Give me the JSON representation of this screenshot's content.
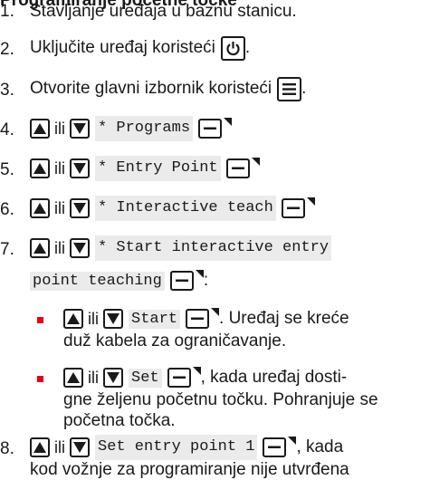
{
  "heading": "Programiranje početne točke",
  "connector": "ili",
  "icons": {
    "power": "power-icon",
    "menu": "menu-icon",
    "up": "up-arrow-icon",
    "down": "down-arrow-icon",
    "ok": "ok-key-icon"
  },
  "accent_color": "#e2001a",
  "steps": [
    {
      "num": "1.",
      "text": "Stavljanje uređaja u baznu stanicu."
    },
    {
      "num": "2.",
      "text_before": "Uključite uređaj koristeći",
      "text_after": "."
    },
    {
      "num": "3.",
      "text_before": "Otvorite glavni izbornik koristeći",
      "text_after": "."
    },
    {
      "num": "4.",
      "command": "* Programs"
    },
    {
      "num": "5.",
      "command": "* Entry Point"
    },
    {
      "num": "6.",
      "command": "* Interactive teach"
    },
    {
      "num": "7.",
      "command_line1": "* Start interactive entry",
      "command_line2": "point teaching",
      "after": ":",
      "bullets": [
        {
          "command": "Start",
          "text_line1": ". Uređaj se kreće",
          "text_line2": "duž kabela za ograničavanje."
        },
        {
          "command": "Set",
          "text_line1": ", kada uređaj dosti-",
          "text_line2": "gne željenu početnu točku. Pohranjuje se",
          "text_line3": "početna točka."
        }
      ]
    },
    {
      "num": "8.",
      "command": "Set entry point 1",
      "text_line1": ", kada",
      "text_line2": "kod vožnje za programiranje nije utvrđena"
    }
  ]
}
